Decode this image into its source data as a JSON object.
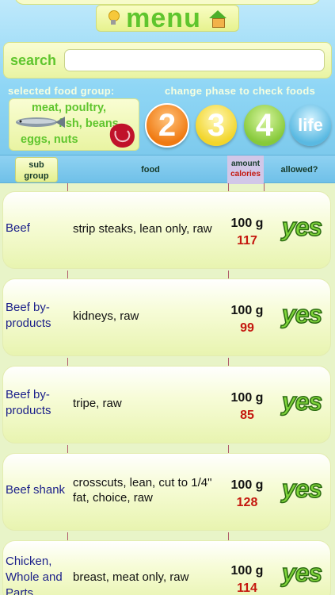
{
  "header": {
    "menu_label": "menu"
  },
  "search": {
    "label": "search",
    "placeholder": ""
  },
  "selected_food_group": {
    "label": "selected food group:",
    "lines": [
      "meat, poultry,",
      "fish, beans",
      "eggs, nuts"
    ]
  },
  "phase": {
    "label": "change phase to check foods",
    "buttons": [
      "2",
      "3",
      "4",
      "life"
    ]
  },
  "table_header": {
    "subgroup": [
      "sub",
      "group"
    ],
    "food": "food",
    "amount": "amount",
    "calories": "calories",
    "allowed": "allowed?"
  },
  "rows": [
    {
      "subgroup": "Beef",
      "food": "strip steaks, lean only, raw",
      "amount": "100 g",
      "calories": "117",
      "allowed": "yes"
    },
    {
      "subgroup": "Beef by-products",
      "food": "kidneys, raw",
      "amount": "100 g",
      "calories": "99",
      "allowed": "yes"
    },
    {
      "subgroup": "Beef by-products",
      "food": "tripe, raw",
      "amount": "100 g",
      "calories": "85",
      "allowed": "yes"
    },
    {
      "subgroup": "Beef shank",
      "food": "crosscuts, lean, cut to 1/4\" fat, choice, raw",
      "amount": "100 g",
      "calories": "128",
      "allowed": "yes"
    },
    {
      "subgroup": "Chicken, Whole and Parts",
      "food": "breast, meat only, raw",
      "amount": "100 g",
      "calories": "114",
      "allowed": "yes"
    }
  ]
}
